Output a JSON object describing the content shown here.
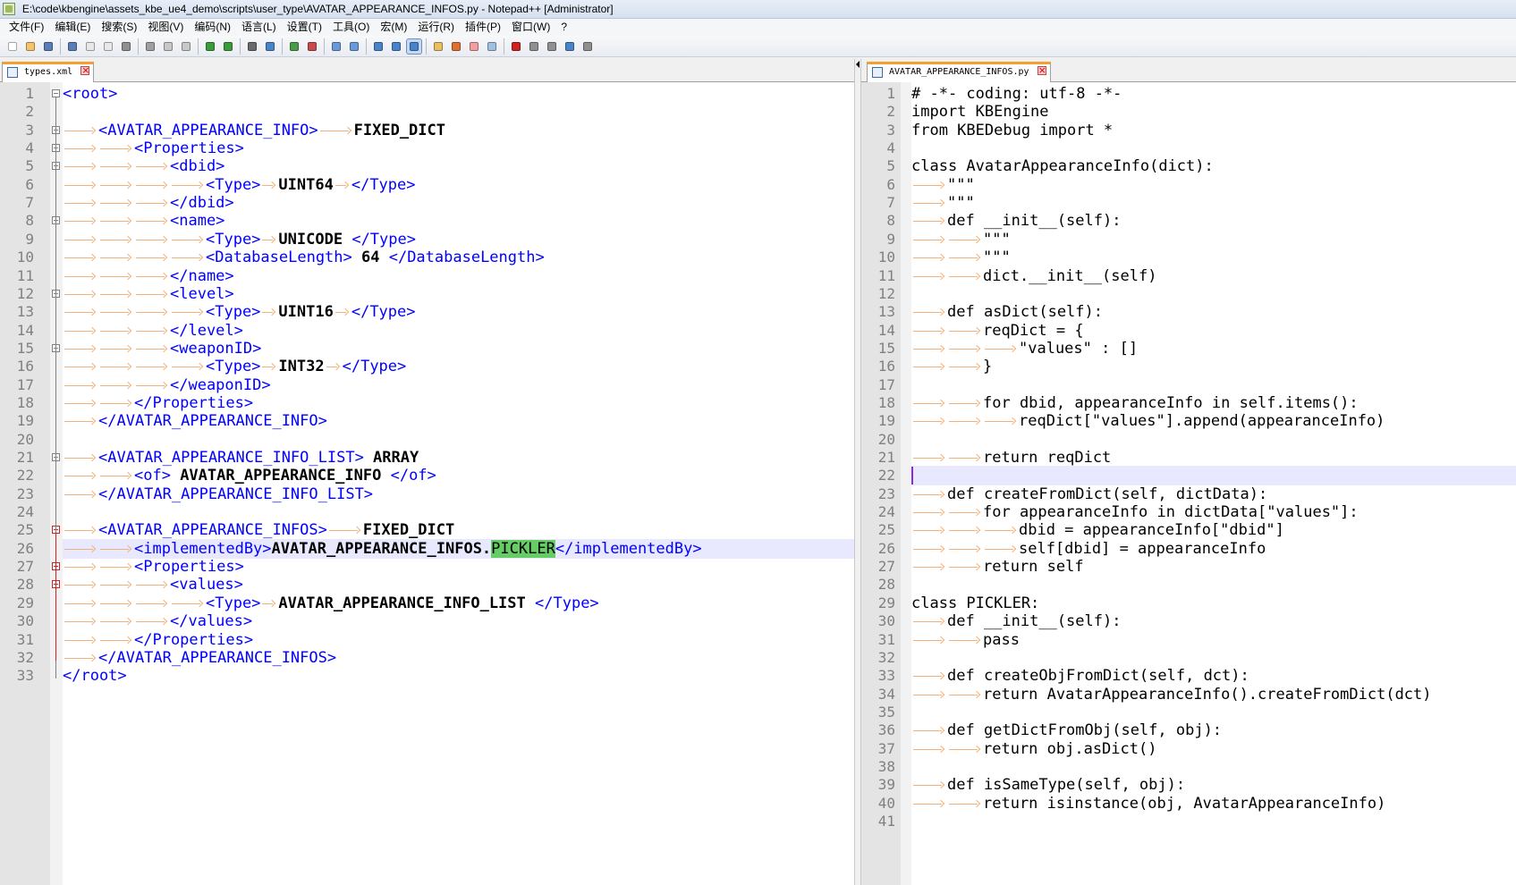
{
  "window": {
    "title": "E:\\code\\kbengine\\assets_kbe_ue4_demo\\scripts\\user_type\\AVATAR_APPEARANCE_INFOS.py - Notepad++ [Administrator]"
  },
  "menu": [
    "文件(F)",
    "编辑(E)",
    "搜索(S)",
    "视图(V)",
    "编码(N)",
    "语言(L)",
    "设置(T)",
    "工具(O)",
    "宏(M)",
    "运行(R)",
    "插件(P)",
    "窗口(W)",
    "?"
  ],
  "toolbar": {
    "buttons": [
      "new-file-icon",
      "open-file-icon",
      "save-icon",
      "save-all-icon",
      "close-icon",
      "close-all-icon",
      "print-icon",
      "cut-icon",
      "copy-icon",
      "paste-icon",
      "undo-icon",
      "redo-icon",
      "find-icon",
      "replace-icon",
      "zoom-in-icon",
      "zoom-out-icon",
      "sync-vertical-icon",
      "sync-horizontal-icon",
      "word-wrap-icon",
      "show-all-chars-icon",
      "indent-guide-icon",
      "document-map-icon",
      "function-list-icon",
      "folder-workspace-icon",
      "monitor-icon",
      "record-macro-icon",
      "stop-macro-icon",
      "play-macro-icon",
      "run-macro-multiple-icon",
      "save-macro-icon"
    ]
  },
  "left_pane": {
    "tab_label": "types.xml",
    "current_line": 26,
    "lines": [
      {
        "n": 1,
        "indent": 0,
        "parts": [
          {
            "t": "<root>",
            "c": "tag"
          }
        ]
      },
      {
        "n": 2,
        "indent": 0,
        "parts": []
      },
      {
        "n": 3,
        "indent": 1,
        "parts": [
          {
            "t": "<AVATAR_APPEARANCE_INFO>",
            "c": "tag"
          },
          {
            "t": "→",
            "c": "arrow"
          },
          {
            "t": "FIXED_DICT",
            "c": "bold"
          }
        ]
      },
      {
        "n": 4,
        "indent": 2,
        "parts": [
          {
            "t": "<Properties>",
            "c": "tag"
          }
        ]
      },
      {
        "n": 5,
        "indent": 3,
        "parts": [
          {
            "t": "<dbid>",
            "c": "tag"
          }
        ]
      },
      {
        "n": 6,
        "indent": 4,
        "parts": [
          {
            "t": "<Type>",
            "c": "tag"
          },
          {
            "t": "→",
            "c": "arrowS"
          },
          {
            "t": "UINT64",
            "c": "bold"
          },
          {
            "t": "→",
            "c": "arrowS"
          },
          {
            "t": "</Type>",
            "c": "tag"
          }
        ]
      },
      {
        "n": 7,
        "indent": 3,
        "parts": [
          {
            "t": "</dbid>",
            "c": "tag"
          }
        ]
      },
      {
        "n": 8,
        "indent": 3,
        "parts": [
          {
            "t": "<name>",
            "c": "tag"
          }
        ]
      },
      {
        "n": 9,
        "indent": 4,
        "parts": [
          {
            "t": "<Type>",
            "c": "tag"
          },
          {
            "t": "→",
            "c": "arrowS"
          },
          {
            "t": "UNICODE",
            "c": "bold"
          },
          {
            "t": " ",
            "c": ""
          },
          {
            "t": "</Type>",
            "c": "tag"
          }
        ]
      },
      {
        "n": 10,
        "indent": 4,
        "parts": [
          {
            "t": "<DatabaseLength>",
            "c": "tag"
          },
          {
            "t": " 64 ",
            "c": "bold"
          },
          {
            "t": "</DatabaseLength>",
            "c": "tag"
          }
        ]
      },
      {
        "n": 11,
        "indent": 3,
        "parts": [
          {
            "t": "</name>",
            "c": "tag"
          }
        ]
      },
      {
        "n": 12,
        "indent": 3,
        "parts": [
          {
            "t": "<level>",
            "c": "tag"
          }
        ]
      },
      {
        "n": 13,
        "indent": 4,
        "parts": [
          {
            "t": "<Type>",
            "c": "tag"
          },
          {
            "t": "→",
            "c": "arrowS"
          },
          {
            "t": "UINT16",
            "c": "bold"
          },
          {
            "t": "→",
            "c": "arrowS"
          },
          {
            "t": "</Type>",
            "c": "tag"
          }
        ]
      },
      {
        "n": 14,
        "indent": 3,
        "parts": [
          {
            "t": "</level>",
            "c": "tag"
          }
        ]
      },
      {
        "n": 15,
        "indent": 3,
        "parts": [
          {
            "t": "<weaponID>",
            "c": "tag"
          }
        ]
      },
      {
        "n": 16,
        "indent": 4,
        "parts": [
          {
            "t": "<Type>",
            "c": "tag"
          },
          {
            "t": "→",
            "c": "arrowS"
          },
          {
            "t": "INT32",
            "c": "bold"
          },
          {
            "t": "→",
            "c": "arrowS"
          },
          {
            "t": "</Type>",
            "c": "tag"
          }
        ]
      },
      {
        "n": 17,
        "indent": 3,
        "parts": [
          {
            "t": "</weaponID>",
            "c": "tag"
          }
        ]
      },
      {
        "n": 18,
        "indent": 2,
        "parts": [
          {
            "t": "</Properties>",
            "c": "tag"
          }
        ]
      },
      {
        "n": 19,
        "indent": 1,
        "parts": [
          {
            "t": "</AVATAR_APPEARANCE_INFO>",
            "c": "tag"
          }
        ]
      },
      {
        "n": 20,
        "indent": 0,
        "parts": []
      },
      {
        "n": 21,
        "indent": 1,
        "parts": [
          {
            "t": "<AVATAR_APPEARANCE_INFO_LIST>",
            "c": "tag"
          },
          {
            "t": " ARRAY",
            "c": "bold"
          }
        ]
      },
      {
        "n": 22,
        "indent": 2,
        "parts": [
          {
            "t": "<of>",
            "c": "tag"
          },
          {
            "t": " AVATAR_APPEARANCE_INFO ",
            "c": "bold"
          },
          {
            "t": "</of>",
            "c": "tag"
          }
        ]
      },
      {
        "n": 23,
        "indent": 1,
        "parts": [
          {
            "t": "</AVATAR_APPEARANCE_INFO_LIST>",
            "c": "tag"
          }
        ]
      },
      {
        "n": 24,
        "indent": 0,
        "parts": []
      },
      {
        "n": 25,
        "indent": 1,
        "parts": [
          {
            "t": "<AVATAR_APPEARANCE_INFOS>",
            "c": "tag"
          },
          {
            "t": "→",
            "c": "arrow"
          },
          {
            "t": "FIXED_DICT",
            "c": "bold"
          }
        ]
      },
      {
        "n": 26,
        "indent": 2,
        "parts": [
          {
            "t": "<implementedBy>",
            "c": "tag"
          },
          {
            "t": "AVATAR_APPEARANCE_INFOS.",
            "c": "bold"
          },
          {
            "t": "PICKLER",
            "c": "hl"
          },
          {
            "t": "</implementedBy>",
            "c": "tag"
          }
        ]
      },
      {
        "n": 27,
        "indent": 2,
        "parts": [
          {
            "t": "<Properties>",
            "c": "tag"
          }
        ]
      },
      {
        "n": 28,
        "indent": 3,
        "parts": [
          {
            "t": "<values>",
            "c": "tag"
          }
        ]
      },
      {
        "n": 29,
        "indent": 4,
        "parts": [
          {
            "t": "<Type>",
            "c": "tag"
          },
          {
            "t": "→",
            "c": "arrowS"
          },
          {
            "t": "AVATAR_APPEARANCE_INFO_LIST",
            "c": "bold"
          },
          {
            "t": " ",
            "c": ""
          },
          {
            "t": "</Type>",
            "c": "tag"
          }
        ]
      },
      {
        "n": 30,
        "indent": 3,
        "parts": [
          {
            "t": "</values>",
            "c": "tag"
          }
        ]
      },
      {
        "n": 31,
        "indent": 2,
        "parts": [
          {
            "t": "</Properties>",
            "c": "tag"
          }
        ]
      },
      {
        "n": 32,
        "indent": 1,
        "parts": [
          {
            "t": "</AVATAR_APPEARANCE_INFOS>",
            "c": "tag"
          }
        ]
      },
      {
        "n": 33,
        "indent": 0,
        "parts": [
          {
            "t": "</root>",
            "c": "tag"
          }
        ]
      }
    ]
  },
  "right_pane": {
    "tab_label": "AVATAR_APPEARANCE_INFOS.py",
    "current_line": 22,
    "lines": [
      {
        "n": 1,
        "indent": 0,
        "text": "# -*- coding: utf-8 -*-"
      },
      {
        "n": 2,
        "indent": 0,
        "text": "import KBEngine"
      },
      {
        "n": 3,
        "indent": 0,
        "text": "from KBEDebug import *"
      },
      {
        "n": 4,
        "indent": 0,
        "text": ""
      },
      {
        "n": 5,
        "indent": 0,
        "text": "class AvatarAppearanceInfo(dict):"
      },
      {
        "n": 6,
        "indent": 1,
        "text": "\"\"\""
      },
      {
        "n": 7,
        "indent": 1,
        "text": "\"\"\""
      },
      {
        "n": 8,
        "indent": 1,
        "text": "def __init__(self):"
      },
      {
        "n": 9,
        "indent": 2,
        "text": "\"\"\""
      },
      {
        "n": 10,
        "indent": 2,
        "text": "\"\"\""
      },
      {
        "n": 11,
        "indent": 2,
        "text": "dict.__init__(self)"
      },
      {
        "n": 12,
        "indent": 0,
        "text": ""
      },
      {
        "n": 13,
        "indent": 1,
        "text": "def asDict(self):"
      },
      {
        "n": 14,
        "indent": 2,
        "text": "reqDict = {"
      },
      {
        "n": 15,
        "indent": 3,
        "text": "\"values\" : []"
      },
      {
        "n": 16,
        "indent": 2,
        "text": "}"
      },
      {
        "n": 17,
        "indent": 0,
        "text": ""
      },
      {
        "n": 18,
        "indent": 2,
        "text": "for dbid, appearanceInfo in self.items():"
      },
      {
        "n": 19,
        "indent": 3,
        "text": "reqDict[\"values\"].append(appearanceInfo)"
      },
      {
        "n": 20,
        "indent": 0,
        "text": ""
      },
      {
        "n": 21,
        "indent": 2,
        "text": "return reqDict"
      },
      {
        "n": 22,
        "indent": 0,
        "text": ""
      },
      {
        "n": 23,
        "indent": 1,
        "text": "def createFromDict(self, dictData):"
      },
      {
        "n": 24,
        "indent": 2,
        "text": "for appearanceInfo in dictData[\"values\"]:"
      },
      {
        "n": 25,
        "indent": 3,
        "text": "dbid = appearanceInfo[\"dbid\"]"
      },
      {
        "n": 26,
        "indent": 3,
        "text": "self[dbid] = appearanceInfo"
      },
      {
        "n": 27,
        "indent": 2,
        "text": "return self"
      },
      {
        "n": 28,
        "indent": 0,
        "text": ""
      },
      {
        "n": 29,
        "indent": 0,
        "text": "class PICKLER:"
      },
      {
        "n": 30,
        "indent": 1,
        "text": "def __init__(self):"
      },
      {
        "n": 31,
        "indent": 2,
        "text": "pass"
      },
      {
        "n": 32,
        "indent": 0,
        "text": ""
      },
      {
        "n": 33,
        "indent": 1,
        "text": "def createObjFromDict(self, dct):"
      },
      {
        "n": 34,
        "indent": 2,
        "text": "return AvatarAppearanceInfo().createFromDict(dct)"
      },
      {
        "n": 35,
        "indent": 0,
        "text": ""
      },
      {
        "n": 36,
        "indent": 1,
        "text": "def getDictFromObj(self, obj):"
      },
      {
        "n": 37,
        "indent": 2,
        "text": "return obj.asDict()"
      },
      {
        "n": 38,
        "indent": 0,
        "text": ""
      },
      {
        "n": 39,
        "indent": 1,
        "text": "def isSameType(self, obj):"
      },
      {
        "n": 40,
        "indent": 2,
        "text": "return isinstance(obj, AvatarAppearanceInfo)"
      },
      {
        "n": 41,
        "indent": 0,
        "text": ""
      }
    ]
  },
  "colors": {
    "tag": "#0000ff",
    "indent_arrow": "#f2b27a",
    "highlight": "#66cc66",
    "current_line": "#e8e8ff",
    "tab_accent": "#f4a030"
  }
}
